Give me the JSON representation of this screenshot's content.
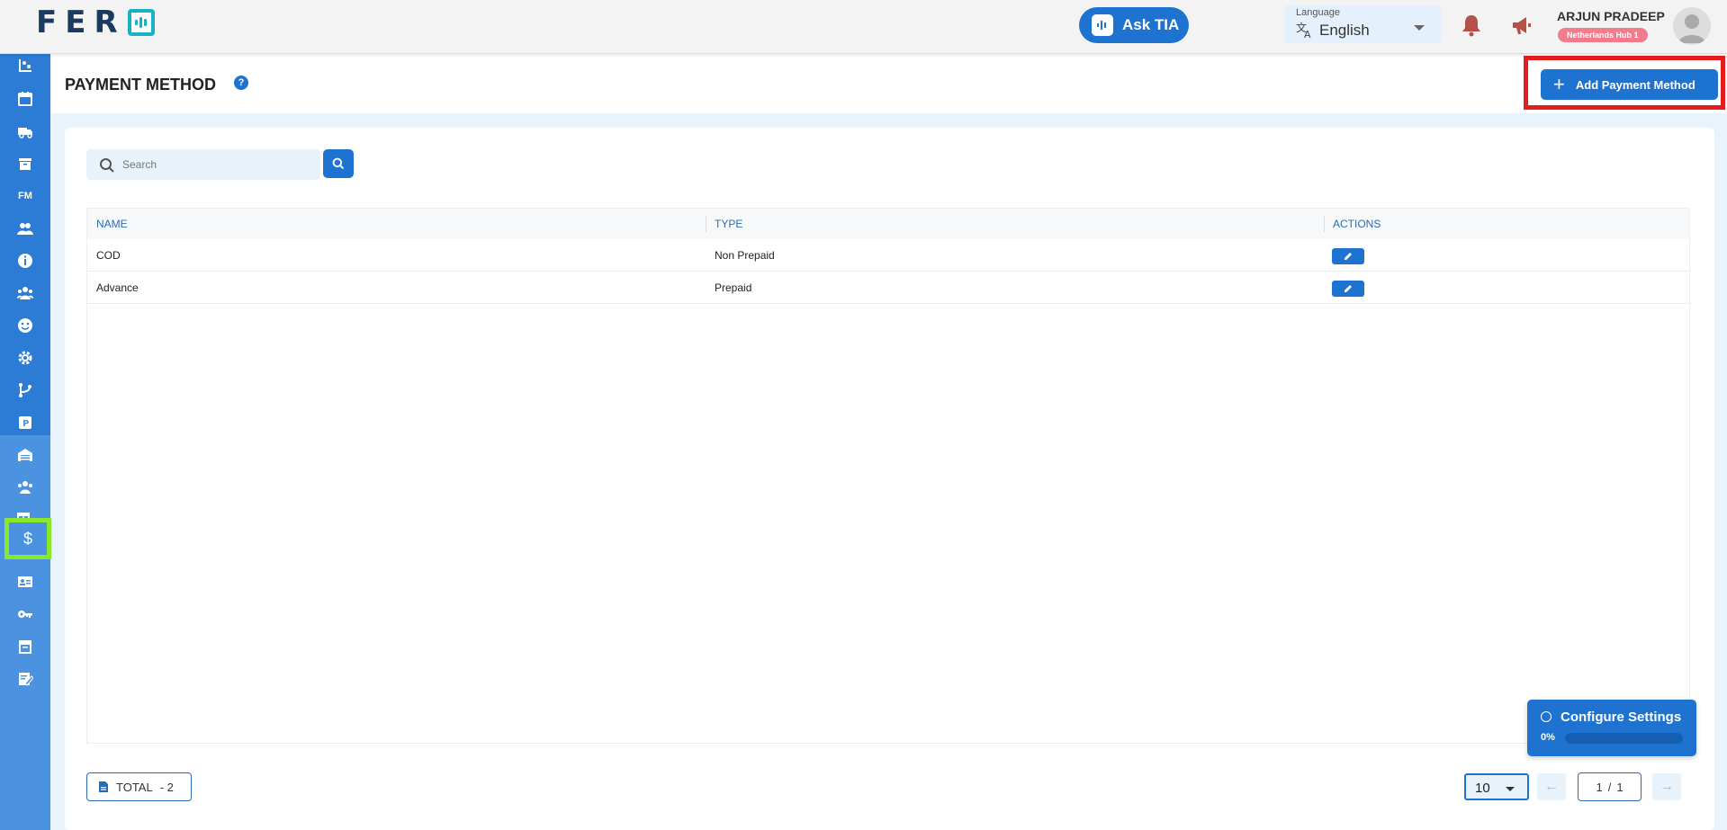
{
  "header": {
    "ask_tia_label": "Ask TIA",
    "language": {
      "label": "Language",
      "value": "English"
    },
    "user": {
      "name": "ARJUN PRADEEP",
      "hub": "Netherlands Hub 1"
    }
  },
  "page": {
    "title": "PAYMENT METHOD",
    "add_button_label": "Add Payment Method"
  },
  "search": {
    "placeholder": "Search",
    "value": ""
  },
  "table": {
    "columns": {
      "name": "NAME",
      "type": "TYPE",
      "actions": "ACTIONS"
    },
    "rows": [
      {
        "name": "COD",
        "type": "Non Prepaid"
      },
      {
        "name": "Advance",
        "type": "Prepaid"
      }
    ]
  },
  "footer": {
    "total_label": "TOTAL",
    "total_value": "- 2",
    "page_size": "10",
    "page_current": "1",
    "page_sep": "/",
    "page_total": "1"
  },
  "config_widget": {
    "title": "Configure Settings",
    "progress_label": "0%",
    "progress": 0
  },
  "colors": {
    "primary": "#1e73d1",
    "sidebar": "#2c7bd4",
    "sidebar_sub": "#4b93e0",
    "highlight_red": "#e51d1d",
    "highlight_green": "#8ae82a",
    "hub_badge": "#f27b8c",
    "notification_icons": "#b5514a"
  },
  "sidebar_icons": [
    "dashboard-icon",
    "calendar-icon",
    "truck-icon",
    "archive-icon",
    "fm-icon",
    "people-icon",
    "info-icon",
    "team-icon",
    "smiley-icon",
    "settings-icon",
    "branch-icon",
    "parking-icon",
    "warehouse-icon",
    "group-icon",
    "table-settings-icon",
    "dollar-icon",
    "id-card-icon",
    "key-icon",
    "printer-icon",
    "note-icon"
  ]
}
